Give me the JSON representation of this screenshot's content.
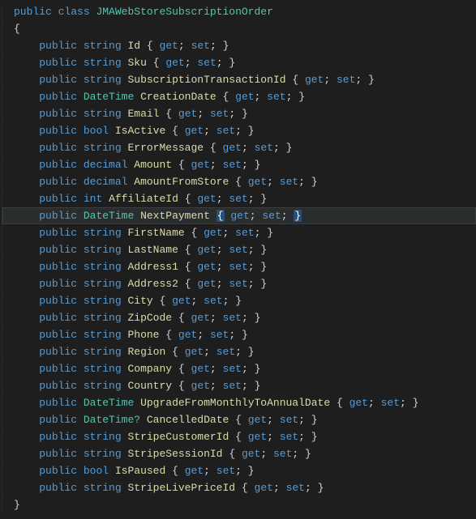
{
  "class_decl": {
    "mod": "public",
    "kw": "class",
    "name": "JMAWebStoreSubscriptionOrder"
  },
  "open_brace": "{",
  "close_brace": "}",
  "kw": {
    "public": "public",
    "get": "get",
    "set": "set"
  },
  "indent": "    ",
  "highlighted_index": 11,
  "props": [
    {
      "type": "string",
      "name": "Id"
    },
    {
      "type": "string",
      "name": "Sku"
    },
    {
      "type": "string",
      "name": "SubscriptionTransactionId"
    },
    {
      "type": "DateTime",
      "name": "CreationDate"
    },
    {
      "type": "string",
      "name": "Email"
    },
    {
      "type": "bool",
      "name": "IsActive"
    },
    {
      "type": "string",
      "name": "ErrorMessage"
    },
    {
      "type": "decimal",
      "name": "Amount"
    },
    {
      "type": "decimal",
      "name": "AmountFromStore"
    },
    {
      "type": "int",
      "name": "AffiliateId"
    },
    {
      "type": "DateTime",
      "name": "NextPayment"
    },
    {
      "type": "string",
      "name": "FirstName"
    },
    {
      "type": "string",
      "name": "LastName"
    },
    {
      "type": "string",
      "name": "Address1"
    },
    {
      "type": "string",
      "name": "Address2"
    },
    {
      "type": "string",
      "name": "City"
    },
    {
      "type": "string",
      "name": "ZipCode"
    },
    {
      "type": "string",
      "name": "Phone"
    },
    {
      "type": "string",
      "name": "Region"
    },
    {
      "type": "string",
      "name": "Company"
    },
    {
      "type": "string",
      "name": "Country"
    },
    {
      "type": "DateTime",
      "name": "UpgradeFromMonthlyToAnnualDate"
    },
    {
      "type": "DateTime?",
      "name": "CancelledDate"
    },
    {
      "type": "string",
      "name": "StripeCustomerId"
    },
    {
      "type": "string",
      "name": "StripeSessionId"
    },
    {
      "type": "bool",
      "name": "IsPaused"
    },
    {
      "type": "string",
      "name": "StripeLivePriceId"
    }
  ]
}
